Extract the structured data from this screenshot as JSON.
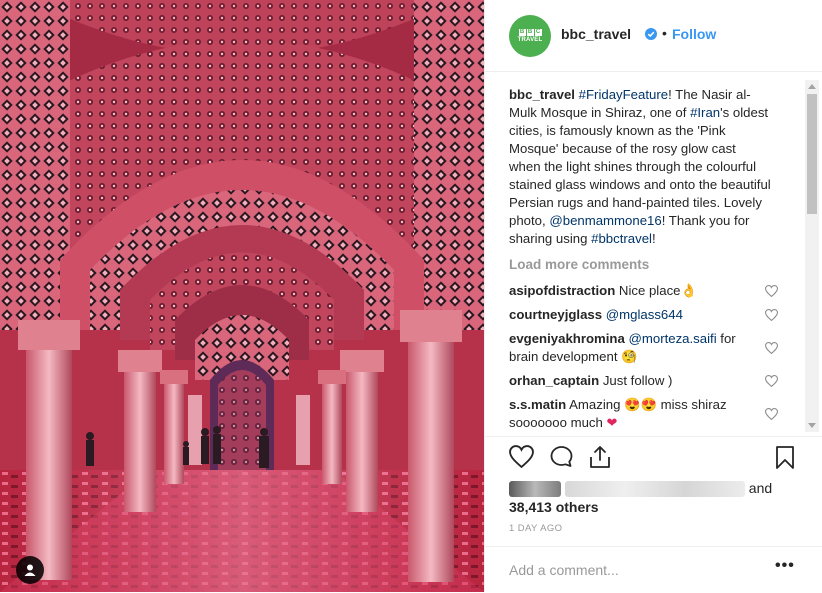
{
  "post": {
    "username": "bbc_travel",
    "follow_label": "Follow",
    "dot": "•",
    "avatar_line1": [
      "B",
      "B",
      "C"
    ],
    "avatar_line2": "TRAVEL"
  },
  "caption": {
    "username": "bbc_travel",
    "hashtag1": "#FridayFeature",
    "text1": "! The Nasir al-Mulk Mosque in Shiraz, one of ",
    "hashtag2": "#Iran",
    "text2": "'s oldest cities, is famously known as the 'Pink Mosque' because of the rosy glow cast when the light shines through the colourful stained glass windows and onto the beautiful Persian rugs and hand-painted tiles. Lovely photo, ",
    "mention": "@benmammone16",
    "text3": "! Thank you for sharing using ",
    "hashtag3": "#bbctravel",
    "text4": "!"
  },
  "load_more": "Load more comments",
  "comments": [
    {
      "user": "asipofdistraction",
      "text": "Nice place",
      "emoji": "👌"
    },
    {
      "user": "courtneyjglass",
      "mention": "@mglass644"
    },
    {
      "user": "evgeniyakhromina",
      "mention": "@morteza.saifi",
      "text": " for brain development",
      "emoji": "🧐"
    },
    {
      "user": "orhan_captain",
      "text": "Just follow )"
    },
    {
      "user": "s.s.matin",
      "text": "Amazing",
      "emoji1": "😍",
      "emoji2": "😍",
      "text2": " miss shiraz sooooooo much",
      "emoji3": "❤"
    }
  ],
  "likes": {
    "and": "and",
    "others": "38,413 others"
  },
  "timestamp": "1 DAY AGO",
  "add_comment_placeholder": "Add a comment...",
  "more_label": "•••",
  "colors": {
    "link": "#003569",
    "follow": "#3897f0",
    "avatar": "#4caf50",
    "muted": "#999999"
  },
  "icons": [
    "user-tag-icon",
    "verified-badge-icon",
    "heart-icon",
    "comment-icon",
    "share-icon",
    "bookmark-icon",
    "more-options-icon"
  ]
}
